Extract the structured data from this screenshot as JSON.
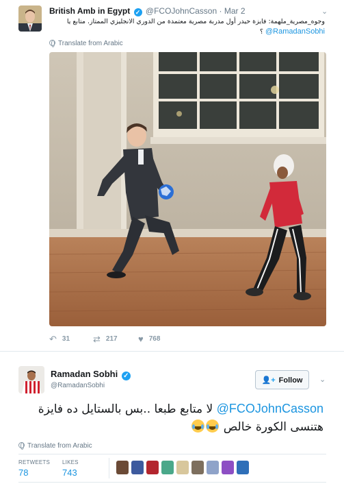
{
  "tweet1": {
    "author_name": "British Amb in Egypt",
    "handle": "@FCOJohnCasson",
    "date": "· Mar 2",
    "text": "وجوه_مصرية_ملهمة: فايزة حيدر أول مدربة مصرية معتمدة من الدوري الانجليزي الممتاز. متابع يا",
    "mention": "@RamadanSobhi",
    "text_end": "؟",
    "translate_label": "Translate from Arabic",
    "replies": "31",
    "retweets": "217",
    "likes": "768"
  },
  "tweet2": {
    "author_name": "Ramadan Sobhi",
    "handle": "@RamadanSobhi",
    "follow_label": "Follow",
    "mention": "@FCOJohnCasson",
    "text_line1": "لا متابع طبعا ..بس بالستايل ده فايزة",
    "text_line2": "هتنسى الكورة خالص",
    "translate_label": "Translate from Arabic",
    "retweets_label": "RETWEETS",
    "retweets": "78",
    "likes_label": "LIKES",
    "likes": "743"
  },
  "colors": {
    "accent": "#1b95e0",
    "verified": "#1da1f2",
    "muted": "#657786"
  },
  "icons": [
    "verified-icon",
    "chevron-down-icon",
    "globe-icon",
    "reply-icon",
    "retweet-icon",
    "like-icon",
    "follow-user-icon",
    "tears-of-joy-emoji"
  ]
}
